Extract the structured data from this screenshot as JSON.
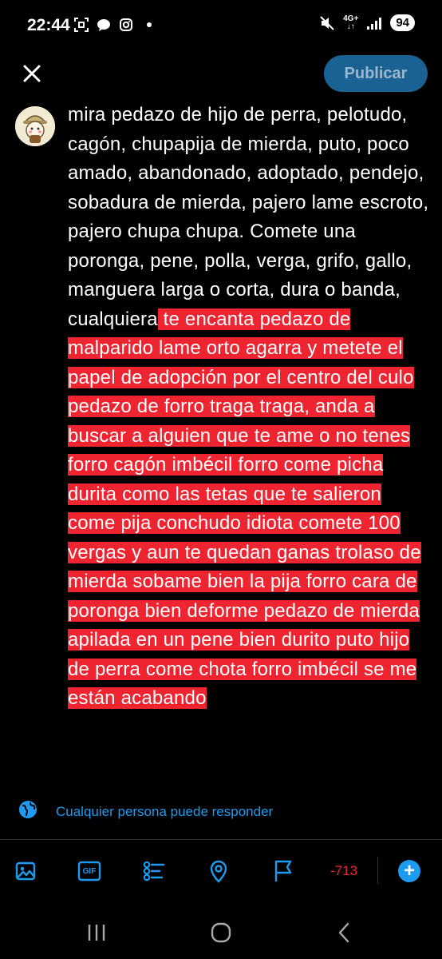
{
  "status_bar": {
    "time": "22:44",
    "network": "4G+",
    "battery": "94",
    "left_icons": [
      "screenshot-icon",
      "chat-icon",
      "instagram-icon",
      "dot-icon"
    ],
    "right_icons": [
      "mute-icon",
      "network-icon",
      "signal-icon",
      "battery-icon"
    ]
  },
  "header": {
    "close_icon": "close-icon",
    "publish_label": "Publicar"
  },
  "composer": {
    "text_plain": "mira pedazo de hijo de perra, pelotudo, cagón, chupapija de mierda, puto, poco amado, abandonado, adoptado, pendejo, sobadura de mierda, pajero lame escroto, pajero chupa chupa. Comete una poronga, pene, polla, verga, grifo, gallo, manguera larga o corta, dura o banda, cualquiera",
    "text_overflow": " te encanta pedazo de malparido lame orto agarra y metete el papel de adopción por el centro del culo pedazo de forro traga traga, anda a buscar a alguien que te ame o no tenes forro cagón imbécil forro come picha durita como las tetas que te salieron come pija conchudo idiota comete 100 vergas y aun te quedan ganas trolaso de mierda sobame bien la pija forro cara de poronga bien deforme pedazo de mierda apilada en un pene bien durito puto hijo de perra come chota forro imbécil se me están acabando",
    "overflow_color": "#ee2430"
  },
  "reply_setting": {
    "icon": "globe-icon",
    "label": "Cualquier persona puede responder"
  },
  "toolbar": {
    "icons": [
      "image-icon",
      "gif-icon",
      "poll-icon",
      "location-icon",
      "flag-icon"
    ],
    "gif_label": "GIF",
    "char_count": "-713",
    "add_icon": "plus-icon"
  },
  "colors": {
    "accent": "#1d9bf0",
    "publish_bg": "#1a6194",
    "error": "#f4212e",
    "background": "#000000"
  },
  "nav_bar": {
    "icons": [
      "recent-apps-icon",
      "home-icon",
      "back-icon"
    ]
  }
}
